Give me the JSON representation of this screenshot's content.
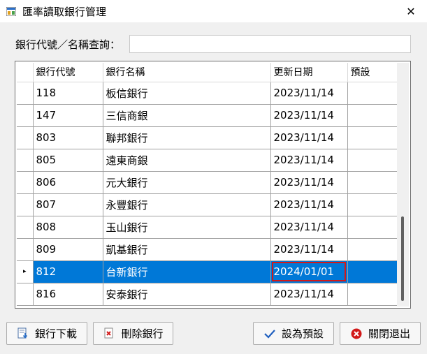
{
  "window": {
    "title": "匯率讀取銀行管理",
    "close_glyph": "✕"
  },
  "search": {
    "label": "銀行代號／名稱查詢：",
    "value": "",
    "placeholder": ""
  },
  "grid": {
    "columns": [
      "銀行代號",
      "銀行名稱",
      "更新日期",
      "預設"
    ],
    "rows": [
      {
        "code": "118",
        "name": "板信銀行",
        "date": "2023/11/14",
        "default": ""
      },
      {
        "code": "147",
        "name": "三信商銀",
        "date": "2023/11/14",
        "default": ""
      },
      {
        "code": "803",
        "name": "聯邦銀行",
        "date": "2023/11/14",
        "default": ""
      },
      {
        "code": "805",
        "name": "遠東商銀",
        "date": "2023/11/14",
        "default": ""
      },
      {
        "code": "806",
        "name": "元大銀行",
        "date": "2023/11/14",
        "default": ""
      },
      {
        "code": "807",
        "name": "永豐銀行",
        "date": "2023/11/14",
        "default": ""
      },
      {
        "code": "808",
        "name": "玉山銀行",
        "date": "2023/11/14",
        "default": ""
      },
      {
        "code": "809",
        "name": "凱基銀行",
        "date": "2023/11/14",
        "default": ""
      },
      {
        "code": "812",
        "name": "台新銀行",
        "date": "2024/01/01",
        "default": "",
        "selected": true,
        "marker": "▸"
      },
      {
        "code": "816",
        "name": "安泰銀行",
        "date": "2023/11/14",
        "default": ""
      }
    ],
    "selected_color": "#0078d7",
    "highlight_color": "#d21919"
  },
  "buttons": {
    "download": {
      "label": "銀行下載",
      "icon": "download-icon"
    },
    "delete": {
      "label": "刪除銀行",
      "icon": "delete-icon"
    },
    "set_default": {
      "label": "設為預設",
      "icon": "checkmark-icon"
    },
    "close": {
      "label": "關閉退出",
      "icon": "close-circle-icon"
    }
  }
}
